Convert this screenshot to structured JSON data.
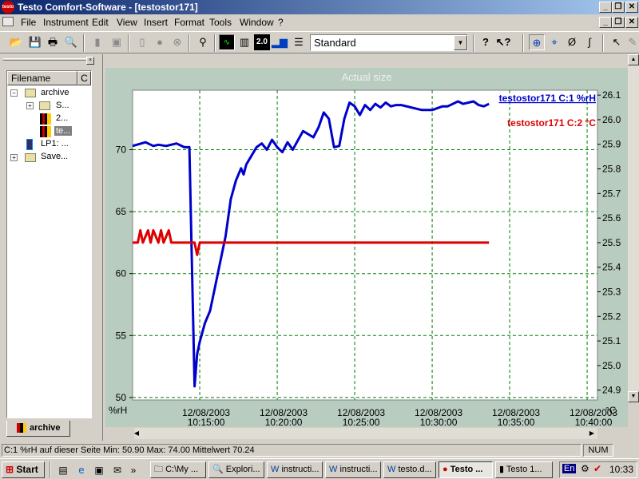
{
  "window": {
    "title": "Testo Comfort-Software - [testostor171]"
  },
  "menu": [
    "File",
    "Instrument",
    "Edit",
    "View",
    "Insert",
    "Format",
    "Tools",
    "Window",
    "?"
  ],
  "toolbar": {
    "combo_value": "Standard",
    "icons": [
      "open-icon",
      "save-icon",
      "print-icon",
      "print-preview-icon",
      "instrument-icon",
      "instrument2-icon",
      "record-icon",
      "stop-icon",
      "binoculars-icon",
      "chart-view-icon",
      "table-view-icon",
      "digital-view-icon",
      "bar-view-icon",
      "list-view-icon",
      "help-icon",
      "context-help-icon",
      "zoom-icon",
      "crosshair-icon",
      "zero-icon",
      "curve-icon",
      "pointer-icon",
      "eraser-icon"
    ]
  },
  "tree": {
    "header": "Filename",
    "header_col": "C",
    "items": [
      {
        "label": "archive",
        "depth": 0,
        "expander": "−"
      },
      {
        "label": "S...",
        "depth": 1,
        "expander": "+"
      },
      {
        "label": "2...",
        "depth": 2,
        "expander": ""
      },
      {
        "label": "te...",
        "depth": 2,
        "expander": "",
        "selected": true
      },
      {
        "label": "LP1: ...",
        "depth": 0,
        "expander": ""
      },
      {
        "label": "Save...",
        "depth": 0,
        "expander": "+"
      }
    ],
    "tab_label": "archive"
  },
  "chart_header": "Actual size",
  "chart_data": {
    "type": "line",
    "series": [
      {
        "name": "testostor171 C:1 %rH",
        "axis": "left",
        "color": "#0000cc",
        "x": [
          "10:10:40",
          "10:11:30",
          "10:12:00",
          "10:12:20",
          "10:12:50",
          "10:13:30",
          "10:14:00",
          "10:14:20",
          "10:14:40",
          "10:14:50",
          "10:15:00",
          "10:15:20",
          "10:15:40",
          "10:16:00",
          "10:16:20",
          "10:16:40",
          "10:17:00",
          "10:17:20",
          "10:17:40",
          "10:17:50",
          "10:18:00",
          "10:18:20",
          "10:18:40",
          "10:19:00",
          "10:19:20",
          "10:19:40",
          "10:20:00",
          "10:20:20",
          "10:20:40",
          "10:21:00",
          "10:21:40",
          "10:22:20",
          "10:22:40",
          "10:23:00",
          "10:23:20",
          "10:23:40",
          "10:24:00",
          "10:24:20",
          "10:24:40",
          "10:25:00",
          "10:25:20",
          "10:25:40",
          "10:26:00",
          "10:26:20",
          "10:26:40",
          "10:27:00",
          "10:27:20",
          "10:27:40",
          "10:28:00",
          "10:28:40",
          "10:29:20",
          "10:30:00",
          "10:30:40",
          "10:31:00",
          "10:31:40",
          "10:32:00",
          "10:32:40",
          "10:33:00",
          "10:33:20",
          "10:33:40"
        ],
        "values": [
          70.3,
          70.6,
          70.3,
          70.4,
          70.3,
          70.5,
          70.2,
          70.2,
          50.9,
          53.5,
          54.5,
          56.0,
          57.0,
          59.0,
          61.0,
          63.0,
          66.0,
          67.5,
          68.5,
          68.0,
          68.8,
          69.5,
          70.2,
          70.5,
          70.0,
          70.8,
          70.2,
          69.8,
          70.6,
          70.0,
          71.5,
          71.0,
          71.8,
          73.0,
          72.5,
          70.2,
          70.3,
          72.5,
          73.8,
          73.5,
          72.8,
          73.6,
          73.2,
          73.7,
          73.4,
          73.8,
          73.5,
          73.6,
          73.6,
          73.4,
          73.2,
          73.2,
          73.5,
          73.5,
          73.9,
          73.7,
          73.9,
          73.6,
          73.5,
          73.7
        ]
      },
      {
        "name": "testostor171 C:2 °C",
        "axis": "right",
        "color": "#dd0000",
        "x": [
          "10:10:40",
          "10:11:00",
          "10:11:10",
          "10:11:20",
          "10:11:40",
          "10:11:50",
          "10:12:00",
          "10:12:20",
          "10:12:30",
          "10:12:40",
          "10:13:00",
          "10:13:10",
          "10:13:20",
          "10:14:00",
          "10:14:40",
          "10:14:50",
          "10:15:00",
          "10:16:00",
          "10:20:00",
          "10:25:00",
          "10:30:00",
          "10:33:40"
        ],
        "values": [
          25.5,
          25.5,
          25.55,
          25.5,
          25.55,
          25.5,
          25.55,
          25.5,
          25.55,
          25.5,
          25.55,
          25.5,
          25.5,
          25.5,
          25.5,
          25.45,
          25.5,
          25.5,
          25.5,
          25.5,
          25.5,
          25.5
        ]
      }
    ],
    "x_ticks": [
      {
        "date": "12/08/2003",
        "time": "10:15:00"
      },
      {
        "date": "12/08/2003",
        "time": "10:20:00"
      },
      {
        "date": "12/08/2003",
        "time": "10:25:00"
      },
      {
        "date": "12/08/2003",
        "time": "10:30:00"
      },
      {
        "date": "12/08/2003",
        "time": "10:35:00"
      },
      {
        "date": "12/08/2003",
        "time": "10:40:00"
      }
    ],
    "xlim": [
      "10:10:40",
      "10:40:40"
    ],
    "y_left": {
      "label": "%rH",
      "ticks": [
        70,
        65,
        60,
        55,
        50
      ],
      "ylim": [
        49.8,
        74.8
      ]
    },
    "y_right": {
      "label": "°C",
      "ticks": [
        26.1,
        26.0,
        25.9,
        25.8,
        25.7,
        25.6,
        25.5,
        25.4,
        25.3,
        25.2,
        25.1,
        25.0,
        24.9
      ],
      "ylim": [
        24.86,
        26.12
      ]
    },
    "grid": true,
    "legend": "top-right"
  },
  "status": {
    "main": "C:1 %rH auf dieser Seite Min: 50.90 Max: 74.00 Mittelwert 70.24",
    "num": "NUM"
  },
  "taskbar": {
    "start": "Start",
    "tasks": [
      "C:\\My ...",
      "Explori...",
      "instructi...",
      "instructi...",
      "testo.d...",
      "Testo ...",
      "Testo 1..."
    ],
    "tray_lang": "En",
    "clock": "10:33"
  }
}
